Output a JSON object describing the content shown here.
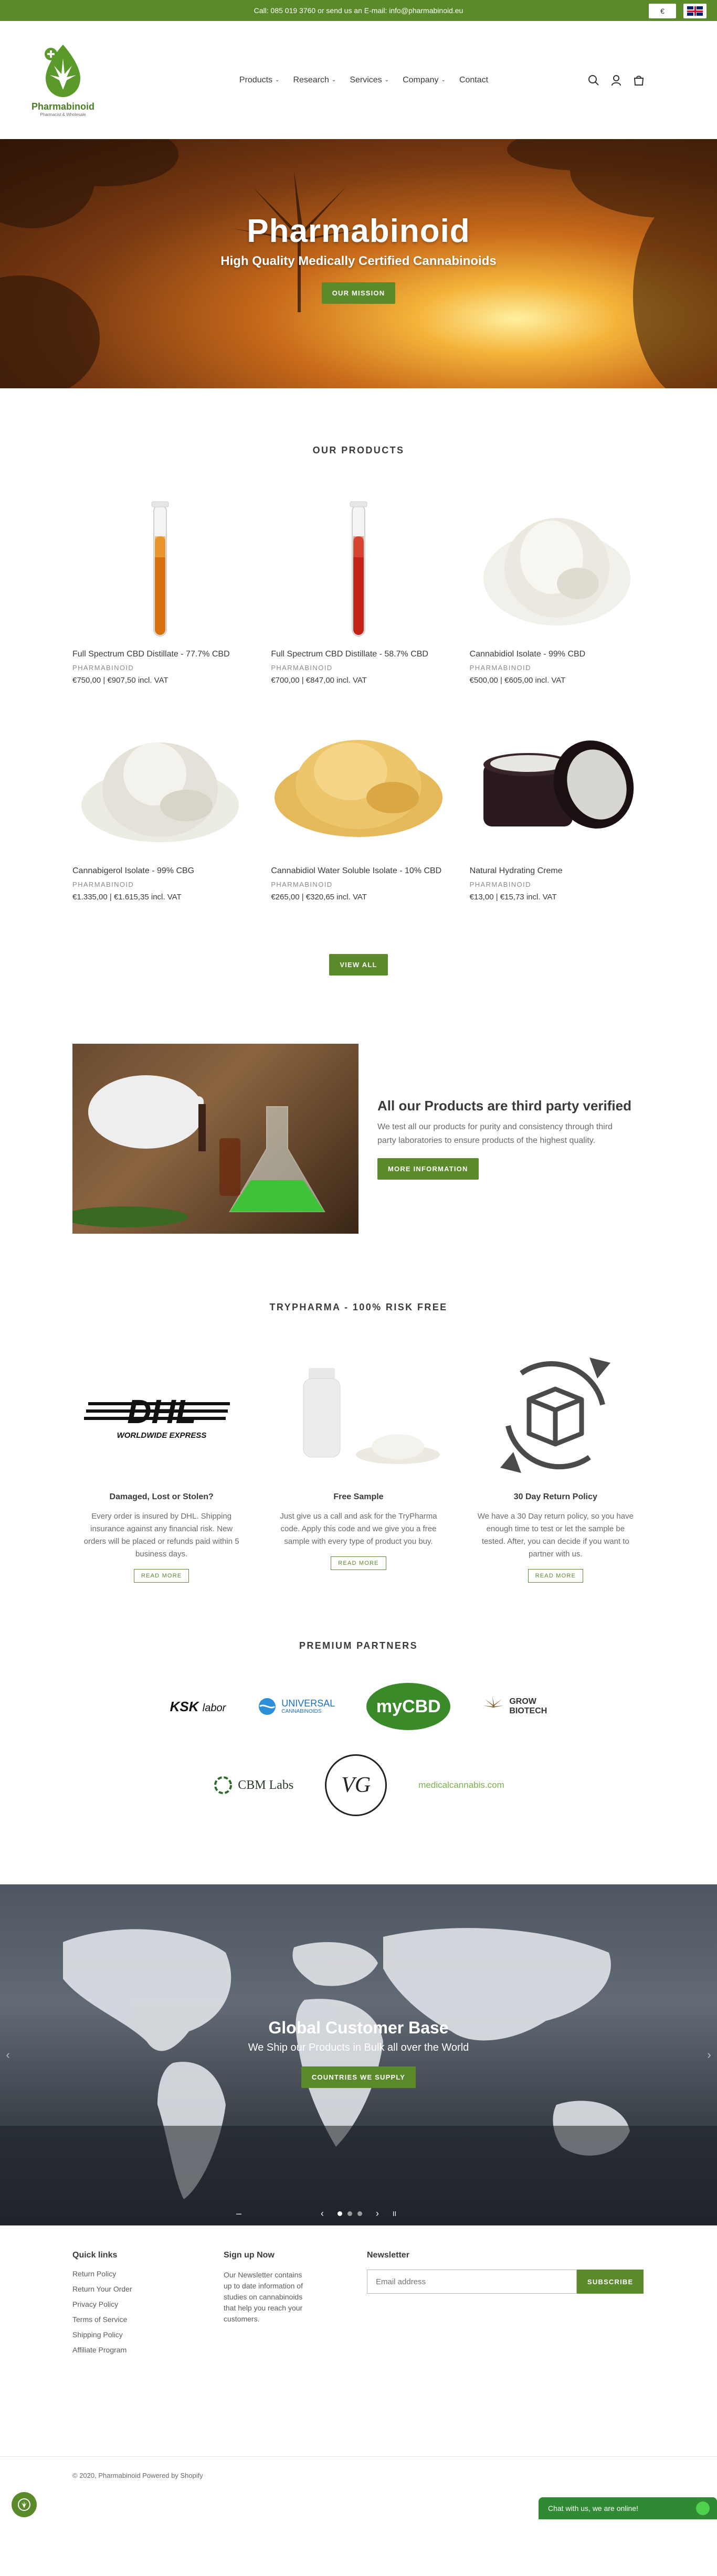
{
  "announcement": {
    "text": "Call: 085 019 3760 or send us an E-mail: info@pharmabinoid.eu",
    "currency": "€"
  },
  "header": {
    "logo_name": "Pharmabinoid",
    "logo_sub": "Pharmacist & Wholesale",
    "nav": [
      {
        "label": "Products",
        "dropdown": true
      },
      {
        "label": "Research",
        "dropdown": true
      },
      {
        "label": "Services",
        "dropdown": true
      },
      {
        "label": "Company",
        "dropdown": true
      },
      {
        "label": "Contact",
        "dropdown": false
      }
    ],
    "icons": [
      "search-icon",
      "user-icon",
      "cart-icon"
    ]
  },
  "hero": {
    "title": "Pharmabinoid",
    "subtitle": "High Quality Medically Certified Cannabinoids",
    "button": "Our Mission"
  },
  "products": {
    "title": "OUR PRODUCTS",
    "items": [
      {
        "name": "Full Spectrum CBD Distillate - 77.7% CBD",
        "vendor": "PHARMABINOID",
        "price": "€750,00 | €907,50 incl. VAT",
        "image": "test-tube-orange"
      },
      {
        "name": "Full Spectrum CBD Distillate - 58.7% CBD",
        "vendor": "PHARMABINOID",
        "price": "€700,00 | €847,00 incl. VAT",
        "image": "test-tube-red"
      },
      {
        "name": "Cannabidiol Isolate - 99% CBD",
        "vendor": "PHARMABINOID",
        "price": "€500,00 | €605,00 incl. VAT",
        "image": "white-powder"
      },
      {
        "name": "Cannabigerol Isolate - 99% CBG",
        "vendor": "PHARMABINOID",
        "price": "€1.335,00 | €1.615,35 incl. VAT",
        "image": "white-powder"
      },
      {
        "name": "Cannabidiol Water Soluble Isolate - 10% CBD",
        "vendor": "PHARMABINOID",
        "price": "€265,00 | €320,65 incl. VAT",
        "image": "yellow-powder"
      },
      {
        "name": "Natural Hydrating Creme",
        "vendor": "PHARMABINOID",
        "price": "€13,00 | €15,73 incl. VAT",
        "image": "cream-jar"
      }
    ],
    "view_all": "View all"
  },
  "third_party": {
    "title": "All our Products are third party verified",
    "text": "We test all our products for purity and consistency through third party laboratories to ensure products of the highest quality.",
    "button": "More information"
  },
  "risk_free": {
    "title": "TRYPHARMA - 100% RISK FREE",
    "items": [
      {
        "title": "Damaged, Lost or Stolen?",
        "text": "Every order is insured by DHL. Shipping insurance against any financial risk. New orders will be placed or refunds paid within 5 business days.",
        "button": "Read more",
        "image_text": "DHL",
        "image_sub": "WORLDWIDE EXPRESS"
      },
      {
        "title": "Free Sample",
        "text": "Just give us a call and ask for the TryPharma code. Apply this code and we give you a free sample with every type of product you buy.",
        "button": "Read more"
      },
      {
        "title": "30 Day Return Policy",
        "text": "We have a 30 Day return policy, so you have enough time to test or let the sample be tested. After, you can decide if you want to partner with us.",
        "button": "Read more"
      }
    ]
  },
  "partners": {
    "title": "PREMIUM PARTNERS",
    "row1": [
      {
        "name": "KSK",
        "extra": "labor"
      },
      {
        "name": "UNIVERSAL",
        "extra": "CANNABINOIDS"
      },
      {
        "name": "myCBD",
        "extra": ""
      },
      {
        "name": "GROW",
        "extra": "BIOTECH"
      }
    ],
    "row2": [
      {
        "name": "CBM Labs",
        "extra": ""
      },
      {
        "name": "VG",
        "extra": ""
      },
      {
        "name": "medicalcannabis.com",
        "extra": ""
      }
    ]
  },
  "global": {
    "title": "Global Customer Base",
    "subtitle": "We Ship our Products in Bulk all over the World",
    "button": "Countries we supply",
    "slides": 3,
    "active_slide": 1
  },
  "footer": {
    "links_title": "Quick links",
    "links": [
      "Return Policy",
      "Return Your Order",
      "Privacy Policy",
      "Terms of Service",
      "Shipping Policy",
      "Affiliate Program"
    ],
    "signup_title": "Sign up Now",
    "signup_text": "Our Newsletter contains up to date information of studies on cannabinoids that help you reach your customers.",
    "newsletter_title": "Newsletter",
    "newsletter_placeholder": "Email address",
    "subscribe": "Subscribe",
    "copyright": "© 2020, Pharmabinoid Powered by Shopify",
    "chat": "Chat with us, we are online!"
  },
  "colors": {
    "brand_green": "#5a8a2a",
    "chat_green": "#2f8a33"
  }
}
